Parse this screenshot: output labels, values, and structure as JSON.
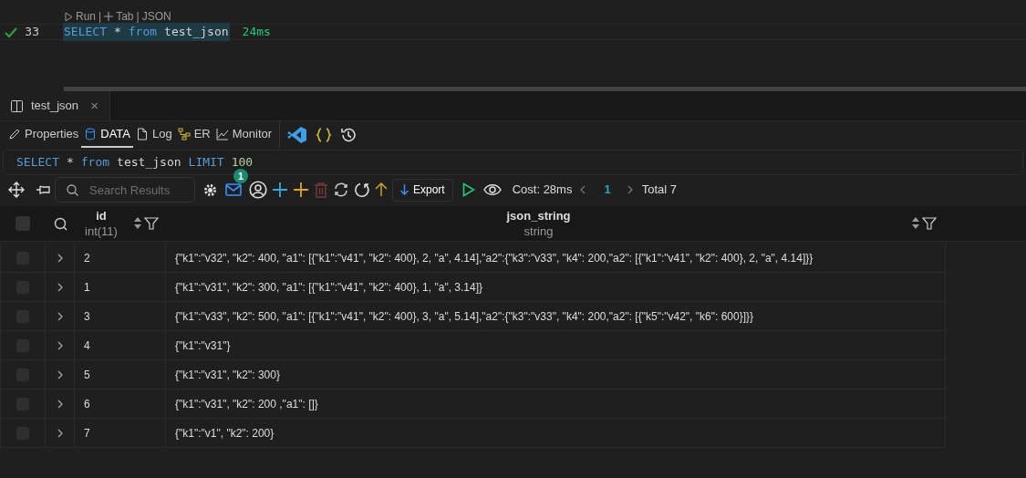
{
  "editor": {
    "codelens": [
      {
        "kind": "run",
        "text": "Run"
      },
      {
        "kind": "sep",
        "text": "|"
      },
      {
        "kind": "tab",
        "text": "Tab"
      },
      {
        "kind": "sep",
        "text": "|"
      },
      {
        "kind": "plain",
        "text": "JSON"
      }
    ],
    "line": {
      "number": "33",
      "succeeded": true,
      "tokens": [
        {
          "kind": "keyword",
          "text": "SELECT"
        },
        {
          "kind": "plain",
          "text": "*"
        },
        {
          "kind": "keyword",
          "text": "from"
        },
        {
          "kind": "plain",
          "text": "test_json"
        }
      ],
      "duration": "24ms"
    }
  },
  "result_tab": {
    "title": "test_json",
    "close": "×"
  },
  "view_tabs": [
    {
      "kind": "properties",
      "label": "Properties",
      "selected": false
    },
    {
      "kind": "data",
      "label": "DATA",
      "selected": true
    },
    {
      "kind": "log",
      "label": "Log",
      "selected": false
    },
    {
      "kind": "er",
      "label": "ER",
      "selected": false
    },
    {
      "kind": "monitor",
      "label": "Monitor",
      "selected": false
    }
  ],
  "sql": [
    {
      "kind": "keyword",
      "text": "SELECT"
    },
    {
      "kind": "plain",
      "text": "*"
    },
    {
      "kind": "keyword",
      "text": "from"
    },
    {
      "kind": "plain",
      "text": "test_json"
    },
    {
      "kind": "keyword",
      "text": "LIMIT"
    },
    {
      "kind": "number",
      "text": "100"
    }
  ],
  "toolbar": {
    "search": {
      "placeholder": "Search Results"
    },
    "badge": "1",
    "export": "Export",
    "cost": "Cost: 28ms",
    "page": "1",
    "total": "Total 7"
  },
  "table": {
    "all_checked": false,
    "columns": [
      {
        "name": "id",
        "type": "int(11)"
      },
      {
        "name": "json_string",
        "type": "string"
      }
    ],
    "rows": [
      {
        "id": "2",
        "checked": false,
        "json_string": "{\"k1\":\"v32\", \"k2\": 400, \"a1\": [{\"k1\":\"v41\", \"k2\": 400}, 2, \"a\", 4.14],\"a2\":{\"k3\":\"v33\", \"k4\": 200,\"a2\": [{\"k1\":\"v41\", \"k2\": 400}, 2, \"a\", 4.14]}}"
      },
      {
        "id": "1",
        "checked": false,
        "json_string": "{\"k1\":\"v31\", \"k2\": 300, \"a1\": [{\"k1\":\"v41\", \"k2\": 400}, 1, \"a\", 3.14]}"
      },
      {
        "id": "3",
        "checked": false,
        "json_string": "{\"k1\":\"v33\", \"k2\": 500, \"a1\": [{\"k1\":\"v41\", \"k2\": 400}, 3, \"a\", 5.14],\"a2\":{\"k3\":\"v33\", \"k4\": 200,\"a2\": [{\"k5\":\"v42\", \"k6\": 600}]}}"
      },
      {
        "id": "4",
        "checked": false,
        "json_string": "{\"k1\":\"v31\"}"
      },
      {
        "id": "5",
        "checked": false,
        "json_string": "{\"k1\":\"v31\", \"k2\": 300}"
      },
      {
        "id": "6",
        "checked": false,
        "json_string": "{\"k1\":\"v31\", \"k2\": 200 ,\"a1\": []}"
      },
      {
        "id": "7",
        "checked": false,
        "json_string": "{\"k1\":\"v1\", \"k2\": 200}"
      }
    ]
  }
}
